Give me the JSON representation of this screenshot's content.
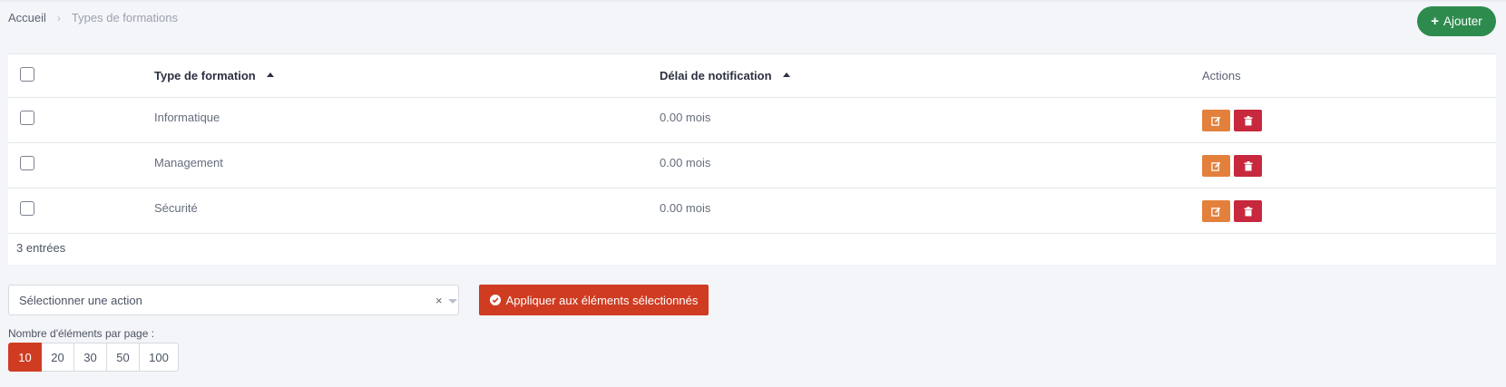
{
  "breadcrumb": {
    "home": "Accueil",
    "separator": "›",
    "current": "Types de formations"
  },
  "toolbar": {
    "add_icon": "+",
    "add_label": "Ajouter"
  },
  "table": {
    "columns": {
      "type": "Type de formation",
      "delay": "Délai de notification",
      "actions": "Actions"
    },
    "rows": [
      {
        "type": "Informatique",
        "delay": "0.00 mois"
      },
      {
        "type": "Management",
        "delay": "0.00 mois"
      },
      {
        "type": "Sécurité",
        "delay": "0.00 mois"
      }
    ],
    "count": "3 entrées"
  },
  "bulk": {
    "placeholder": "Sélectionner une action",
    "clear": "×",
    "apply_label": "Appliquer aux éléments sélectionnés"
  },
  "pagination": {
    "label": "Nombre d'éléments par page :",
    "options": [
      "10",
      "20",
      "30",
      "50",
      "100"
    ],
    "active": "10"
  },
  "colors": {
    "add": "#2e8b4e",
    "edit": "#e3813c",
    "delete": "#c7283d",
    "apply": "#cf3c22"
  },
  "icons": {
    "edit": "edit-icon",
    "delete": "trash-icon",
    "apply": "check-circle-icon"
  }
}
